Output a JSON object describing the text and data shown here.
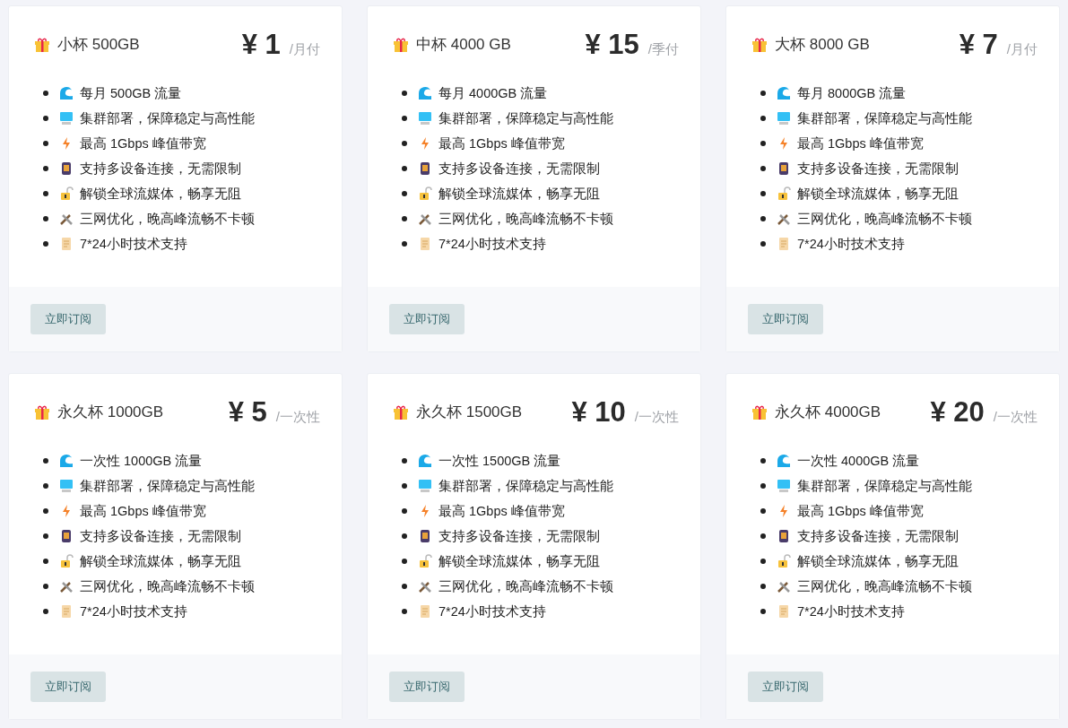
{
  "plans": [
    {
      "name": "小杯 500GB",
      "price": "¥ 1",
      "period": "/月付",
      "features": [
        "每月 500GB 流量",
        "集群部署，保障稳定与高性能",
        "最高 1Gbps 峰值带宽",
        "支持多设备连接，无需限制",
        "解锁全球流媒体，畅享无阻",
        "三网优化，晚高峰流畅不卡顿",
        "7*24小时技术支持"
      ],
      "button": "立即订阅"
    },
    {
      "name": "中杯 4000 GB",
      "price": "¥ 15",
      "period": "/季付",
      "features": [
        "每月 4000GB 流量",
        "集群部署，保障稳定与高性能",
        "最高 1Gbps 峰值带宽",
        "支持多设备连接，无需限制",
        "解锁全球流媒体，畅享无阻",
        "三网优化，晚高峰流畅不卡顿",
        "7*24小时技术支持"
      ],
      "button": "立即订阅"
    },
    {
      "name": "大杯 8000 GB",
      "price": "¥ 7",
      "period": "/月付",
      "features": [
        "每月 8000GB 流量",
        "集群部署，保障稳定与高性能",
        "最高 1Gbps 峰值带宽",
        "支持多设备连接，无需限制",
        "解锁全球流媒体，畅享无阻",
        "三网优化，晚高峰流畅不卡顿",
        "7*24小时技术支持"
      ],
      "button": "立即订阅"
    },
    {
      "name": "永久杯 1000GB",
      "price": "¥ 5",
      "period": "/一次性",
      "features": [
        "一次性 1000GB 流量",
        "集群部署，保障稳定与高性能",
        "最高 1Gbps 峰值带宽",
        "支持多设备连接，无需限制",
        "解锁全球流媒体，畅享无阻",
        "三网优化，晚高峰流畅不卡顿",
        "7*24小时技术支持"
      ],
      "button": "立即订阅"
    },
    {
      "name": "永久杯 1500GB",
      "price": "¥ 10",
      "period": "/一次性",
      "features": [
        "一次性 1500GB 流量",
        "集群部署，保障稳定与高性能",
        "最高 1Gbps 峰值带宽",
        "支持多设备连接，无需限制",
        "解锁全球流媒体，畅享无阻",
        "三网优化，晚高峰流畅不卡顿",
        "7*24小时技术支持"
      ],
      "button": "立即订阅"
    },
    {
      "name": "永久杯 4000GB",
      "price": "¥ 20",
      "period": "/一次性",
      "features": [
        "一次性 4000GB 流量",
        "集群部署，保障稳定与高性能",
        "最高 1Gbps 峰值带宽",
        "支持多设备连接，无需限制",
        "解锁全球流媒体，畅享无阻",
        "三网优化，晚高峰流畅不卡顿",
        "7*24小时技术支持"
      ],
      "button": "立即订阅"
    }
  ]
}
